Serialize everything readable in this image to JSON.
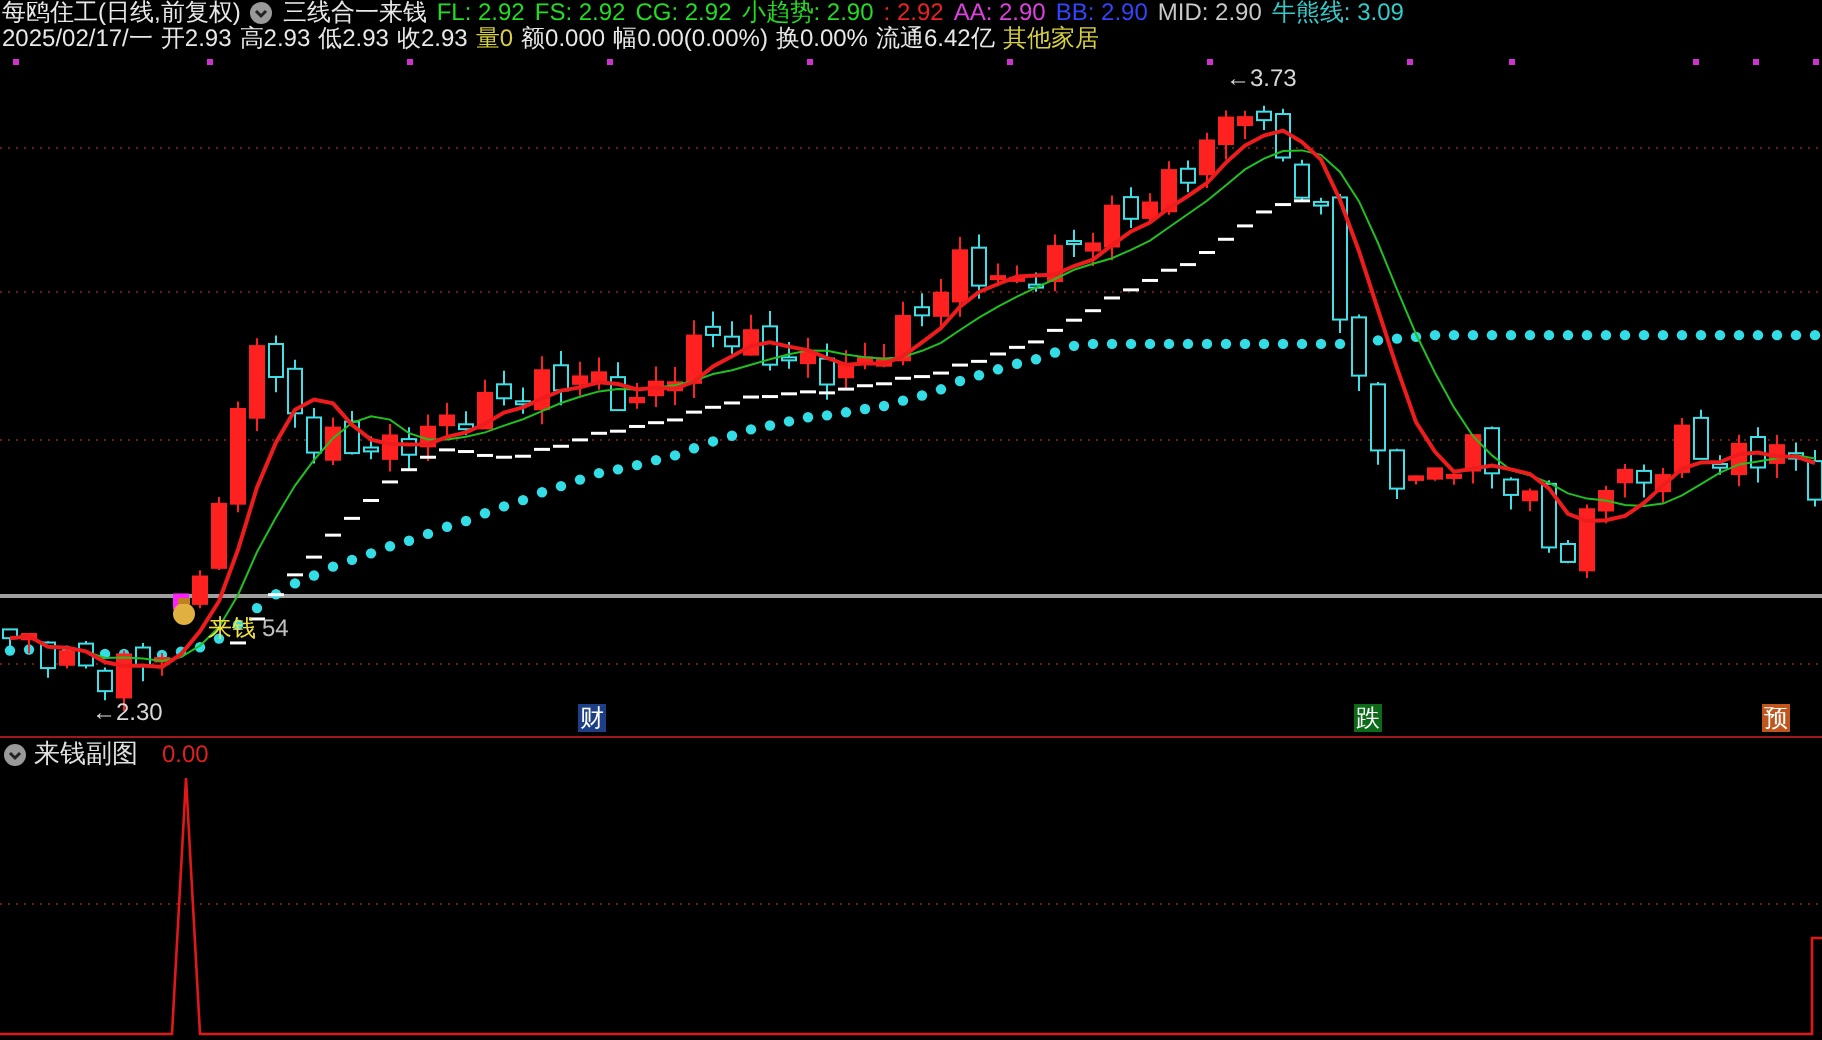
{
  "header": {
    "title": "每鸥住工(日线,前复权)",
    "formula": "三线合一来钱",
    "indicators": [
      {
        "text": "FL: 2.92",
        "color": "#22dd22"
      },
      {
        "text": "FS: 2.92",
        "color": "#22dd22"
      },
      {
        "text": "CG: 2.92",
        "color": "#22dd22"
      },
      {
        "text": "小趋势: 2.90",
        "color": "#22dd22"
      },
      {
        "text": ": 2.92",
        "color": "#ee2222"
      },
      {
        "text": "AA: 2.90",
        "color": "#e040e0"
      },
      {
        "text": "BB: 2.90",
        "color": "#3344ff"
      },
      {
        "text": "MID: 2.90",
        "color": "#c8c8c8"
      },
      {
        "text": "牛熊线: 3.09",
        "color": "#33cccc"
      }
    ]
  },
  "quote": {
    "date": "2025/02/17/一",
    "fields": [
      {
        "text": "开2.93",
        "color": "#e8e8e8"
      },
      {
        "text": "高2.93",
        "color": "#e8e8e8"
      },
      {
        "text": "低2.93",
        "color": "#e8e8e8"
      },
      {
        "text": "收2.93",
        "color": "#e8e8e8"
      },
      {
        "text": "量0",
        "color": "#d8d040"
      },
      {
        "text": "额0.000",
        "color": "#e8e8e8"
      },
      {
        "text": "幅0.00(0.00%)",
        "color": "#e8e8e8"
      },
      {
        "text": "换0.00%",
        "color": "#e8e8e8"
      },
      {
        "text": "流通6.42亿",
        "color": "#e8e8e8"
      },
      {
        "text": "其他家居",
        "color": "#d8d040"
      }
    ]
  },
  "main_chart": {
    "high_label": "←3.73",
    "low_label": "←2.30",
    "signal": {
      "label": "来钱",
      "count": "54"
    },
    "markers": [
      {
        "text": "财",
        "color": "#1c3f86"
      },
      {
        "text": "跌",
        "color": "#0c6a18"
      },
      {
        "text": "预",
        "color": "#c0561c"
      }
    ]
  },
  "sub_chart": {
    "title": "来钱副图",
    "value": "0.00"
  }
}
